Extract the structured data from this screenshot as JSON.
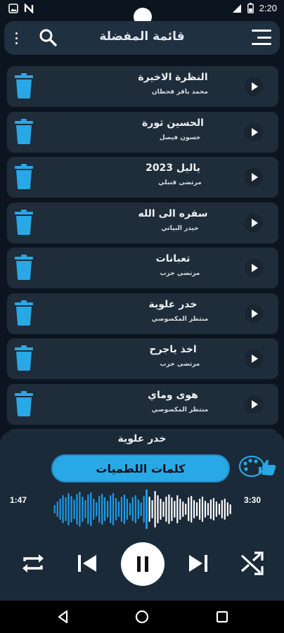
{
  "status_bar": {
    "time": "2:20"
  },
  "app_bar": {
    "title": "قائمة المفضلة"
  },
  "playlist": [
    {
      "song": "النظرة الاخيرة",
      "artist": "محمد باقر قحطان"
    },
    {
      "song": "الحسين ثورة",
      "artist": "حسون فيصل"
    },
    {
      "song": "ياليل 2023",
      "artist": "مرتضى قنبلي"
    },
    {
      "song": "سفره الى الله",
      "artist": "حيدر البياتي"
    },
    {
      "song": "تعبانات",
      "artist": "مرتضى حرب"
    },
    {
      "song": "خدر علوية",
      "artist": "منتظر المكصوصي"
    },
    {
      "song": "اخذ ياجرح",
      "artist": "مرتضى حرب"
    },
    {
      "song": "هوى وماي",
      "artist": "منتظر المكصوصي"
    }
  ],
  "player": {
    "now_playing": "خدر علوية",
    "lyrics_button": "كلمات اللطميات",
    "current_time": "1:47",
    "total_time": "3:30",
    "progress": 0.51
  },
  "colors": {
    "accent": "#29a8e6",
    "wave_played": "#1e9be6",
    "wave_remaining": "#ffffff",
    "trash": "#29a8e6"
  },
  "icons": [
    "menu-dots-icon",
    "search-icon",
    "hamburger-icon",
    "trash-icon",
    "play-icon",
    "palette-icon",
    "repeat-icon",
    "skip-previous-icon",
    "pause-icon",
    "skip-next-icon",
    "shuffle-icon",
    "nav-back-icon",
    "nav-home-icon",
    "nav-recents-icon"
  ]
}
